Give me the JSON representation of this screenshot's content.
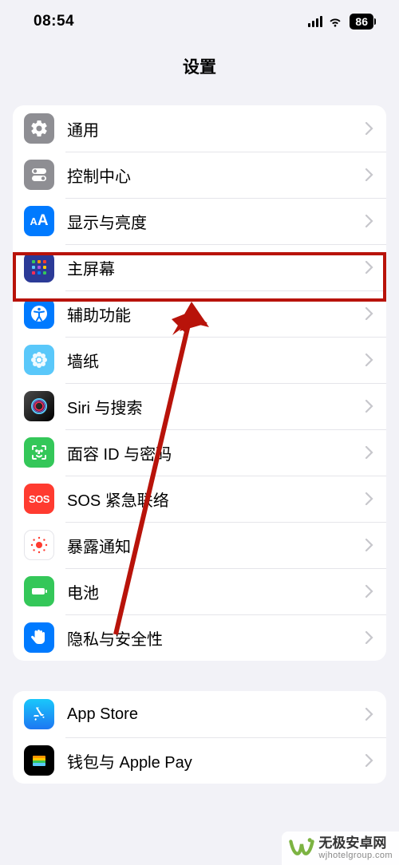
{
  "status": {
    "time": "08:54",
    "battery": "86"
  },
  "header": {
    "title": "设置"
  },
  "groups": [
    {
      "rows": [
        {
          "key": "general",
          "label": "通用"
        },
        {
          "key": "control-center",
          "label": "控制中心"
        },
        {
          "key": "display",
          "label": "显示与亮度"
        },
        {
          "key": "home-screen",
          "label": "主屏幕"
        },
        {
          "key": "accessibility",
          "label": "辅助功能"
        },
        {
          "key": "wallpaper",
          "label": "墙纸"
        },
        {
          "key": "siri",
          "label": "Siri 与搜索"
        },
        {
          "key": "faceid",
          "label": "面容 ID 与密码"
        },
        {
          "key": "sos",
          "label": "SOS 紧急联络",
          "iconText": "SOS"
        },
        {
          "key": "exposure",
          "label": "暴露通知"
        },
        {
          "key": "battery",
          "label": "电池"
        },
        {
          "key": "privacy",
          "label": "隐私与安全性"
        }
      ]
    },
    {
      "rows": [
        {
          "key": "appstore",
          "label": "App Store"
        },
        {
          "key": "wallet",
          "label": "钱包与 Apple Pay"
        }
      ]
    }
  ],
  "annotations": {
    "highlight_key": "home-screen",
    "arrow_color": "#b8130a"
  },
  "watermark": {
    "main": "无极安卓网",
    "sub": "wjhotelgroup.com"
  }
}
